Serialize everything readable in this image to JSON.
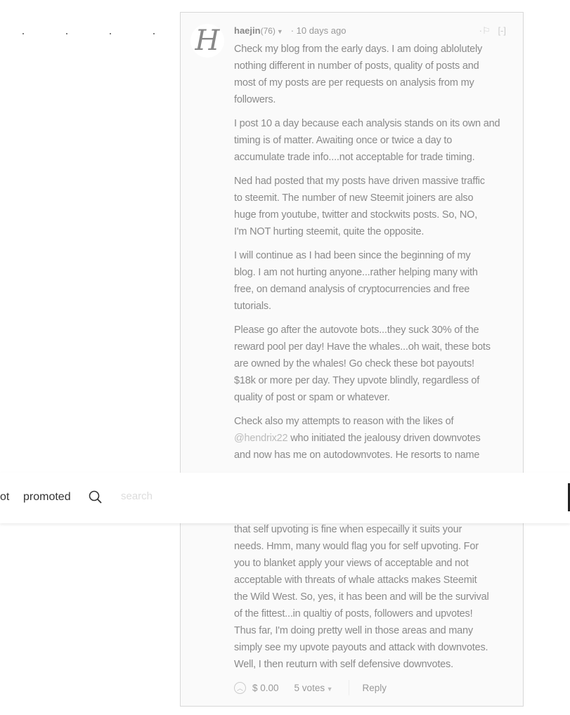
{
  "comment": {
    "avatar_letter": "H",
    "author": "haejin",
    "reputation": "(76)",
    "timestamp": "· 10 days ago",
    "flag_icon": "flag-icon",
    "collapse_label": "[-]",
    "paragraphs": [
      [
        "Check my blog from the early days. I am doing ablolutely",
        "nothing different in number of posts, quality of posts and",
        "most of my posts are per requests on analysis from my",
        "followers."
      ],
      [
        "I post 10 a day because each analysis stands on its own and",
        "timing is of matter. Awaiting once or twice a day to",
        "accumulate trade info....not acceptable for trade timing."
      ],
      [
        "Ned had posted that my posts have driven massive traffic",
        "to steemit. The number of new Steemit joiners are also",
        "huge from youtube, twitter and stockwits posts. So, NO,",
        "I'm NOT hurting steemit, quite the opposite."
      ],
      [
        "I will continue as I had been since the beginning of my",
        "blog. I am not hurting anyone...rather helping many with",
        "free, on demand analysis of cryptocurrencies and free",
        "tutorials."
      ],
      [
        "Please go after the autovote bots...they suck 30% of the",
        "reward pool per day! Have the whales...oh wait, these bots",
        "are owned by the whales! Go check these bot payouts!",
        "$18k or more per day. They upvote blindly, regardless of",
        "quality of post or spam or whatever."
      ]
    ],
    "para6_line1": "Check also my attempts to reason with the likes of",
    "mention": "@hendrix22",
    "para6_line2_rest": " who initiated the jealousy driven downvotes",
    "para6_line3": "and now has me on autodownvotes. He resorts to name",
    "para7": [
      "that self upvoting is fine when especailly it suits your",
      "needs. Hmm, many would flag you for self upvoting. For",
      "you to blanket apply your views of acceptable and not",
      "acceptable with threats of whale attacks makes Steemit",
      "the Wild West. So, yes, it has been and will be the survival",
      "of the fittest...in qualtiy of posts, followers and upvotes!",
      "Thus far, I'm doing pretty well in those areas and many",
      "simply see my upvote payouts and attack with downvotes.",
      "Well, I then reuturn with self defensive downvotes."
    ],
    "payout": "$ 0.00",
    "votes": "5 votes",
    "reply_label": "Reply"
  },
  "header": {
    "nav_partial": "ot",
    "nav_promoted": "promoted",
    "search_placeholder": "search"
  }
}
